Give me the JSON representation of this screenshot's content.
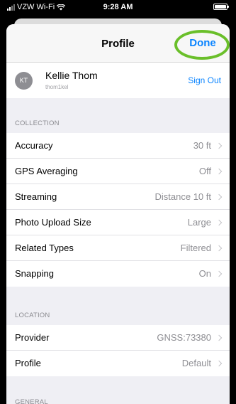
{
  "status_bar": {
    "carrier": "VZW Wi-Fi",
    "time": "9:28 AM"
  },
  "nav": {
    "title": "Profile",
    "done_label": "Done"
  },
  "account": {
    "initials": "KT",
    "name": "Kellie Thom",
    "username": "thom1kel",
    "sign_out_label": "Sign Out"
  },
  "sections": {
    "collection": {
      "header": "COLLECTION",
      "rows": [
        {
          "label": "Accuracy",
          "value": "30 ft"
        },
        {
          "label": "GPS Averaging",
          "value": "Off"
        },
        {
          "label": "Streaming",
          "value": "Distance 10 ft"
        },
        {
          "label": "Photo Upload Size",
          "value": "Large"
        },
        {
          "label": "Related Types",
          "value": "Filtered"
        },
        {
          "label": "Snapping",
          "value": "On"
        }
      ]
    },
    "location": {
      "header": "LOCATION",
      "rows": [
        {
          "label": "Provider",
          "value": "GNSS:73380"
        },
        {
          "label": "Profile",
          "value": "Default"
        }
      ]
    },
    "general": {
      "header": "GENERAL"
    }
  },
  "colors": {
    "accent": "#0a84ff",
    "highlight": "#6abf2a",
    "background": "#efeff4"
  }
}
